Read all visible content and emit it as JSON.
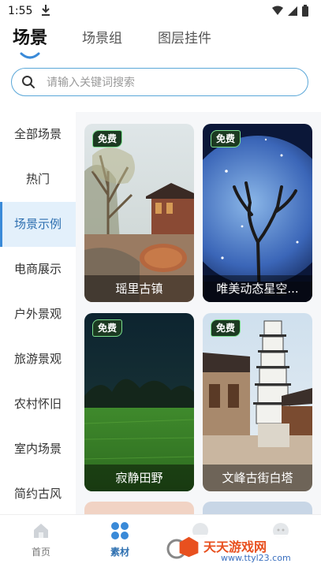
{
  "status": {
    "time": "1:55"
  },
  "top_tabs": [
    {
      "label": "场景",
      "active": true
    },
    {
      "label": "场景组",
      "active": false
    },
    {
      "label": "图层挂件",
      "active": false
    }
  ],
  "search": {
    "placeholder": "请输入关键词搜索",
    "value": ""
  },
  "categories": [
    {
      "label": "全部场景"
    },
    {
      "label": "热门"
    },
    {
      "label": "场景示例",
      "active": true
    },
    {
      "label": "电商展示"
    },
    {
      "label": "户外景观"
    },
    {
      "label": "旅游景观"
    },
    {
      "label": "农村怀旧"
    },
    {
      "label": "室内场景"
    },
    {
      "label": "简约古风"
    }
  ],
  "cards": [
    {
      "title": "瑶里古镇",
      "badge": "免费"
    },
    {
      "title": "唯美动态星空...",
      "badge": "免费"
    },
    {
      "title": "寂静田野",
      "badge": "免费"
    },
    {
      "title": "文峰古街白塔",
      "badge": "免费"
    }
  ],
  "bottom_nav": [
    {
      "label": "首页",
      "icon": "home-icon"
    },
    {
      "label": "素材",
      "icon": "material-grid-icon",
      "active": true
    },
    {
      "label": "",
      "icon": "circle-icon"
    },
    {
      "label": "",
      "icon": "profile-icon"
    }
  ],
  "watermark": {
    "title": "天天游戏网",
    "url": "www.ttyl23.com"
  },
  "colors": {
    "accent": "#3a8ad8",
    "active_bg": "#e3f0fb",
    "badge_border": "#7be08e"
  }
}
